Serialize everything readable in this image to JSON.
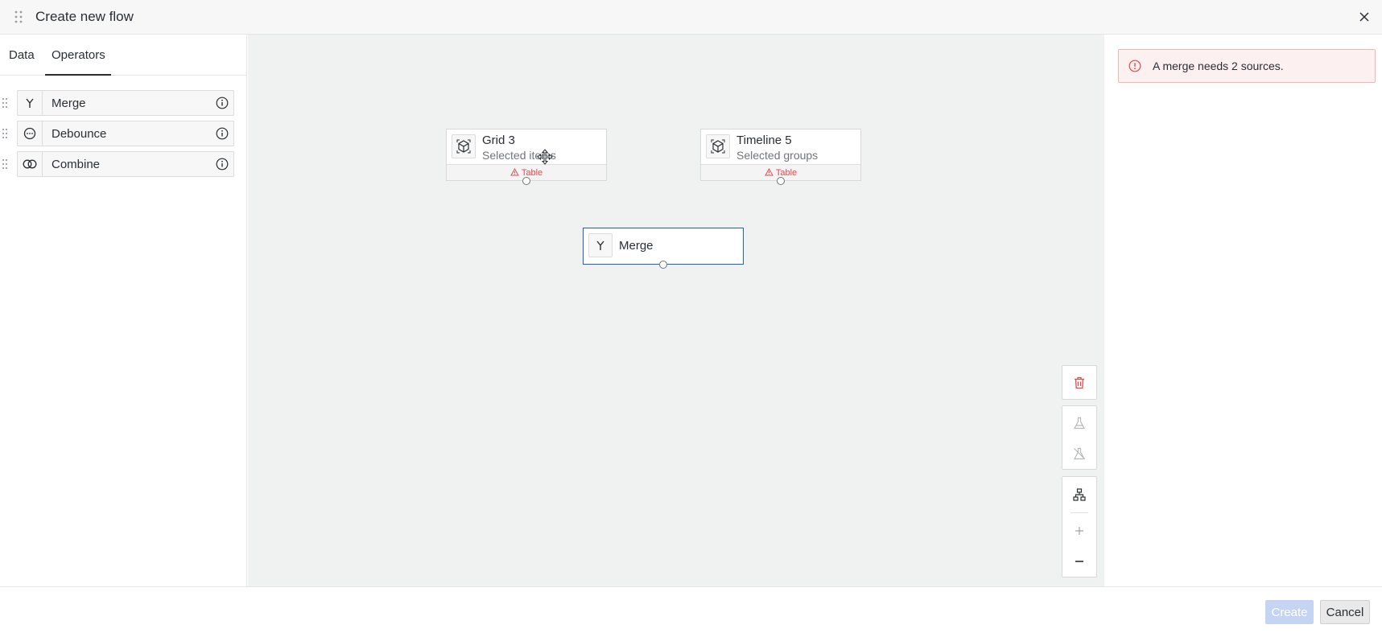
{
  "header": {
    "title": "Create new flow",
    "icons": {
      "grip": "drag-grip-icon",
      "close": "close-icon"
    }
  },
  "left_panel": {
    "tabs": [
      {
        "label": "Data",
        "active": false
      },
      {
        "label": "Operators",
        "active": true
      }
    ],
    "operators": [
      {
        "label": "Merge",
        "icon": "merge-icon"
      },
      {
        "label": "Debounce",
        "icon": "debounce-icon"
      },
      {
        "label": "Combine",
        "icon": "combine-icon"
      }
    ]
  },
  "canvas": {
    "nodes": [
      {
        "title": "Grid 3",
        "subtitle": "Selected items",
        "warning": "Table",
        "icon": "cube-icon"
      },
      {
        "title": "Timeline 5",
        "subtitle": "Selected groups",
        "warning": "Table",
        "icon": "cube-icon"
      },
      {
        "title": "Merge",
        "icon": "merge-icon",
        "selected": true
      }
    ],
    "controls": [
      "delete-icon",
      "flask-icon",
      "flask-off-icon",
      "hierarchy-icon",
      "plus-icon",
      "minus-icon"
    ]
  },
  "right_panel": {
    "error": {
      "message": "A merge needs 2 sources."
    }
  },
  "footer": {
    "create_label": "Create",
    "cancel_label": "Cancel"
  },
  "colors": {
    "accent": "#1e5fc7",
    "error": "#e5484d",
    "error_bg": "#fdf0f0",
    "canvas_bg": "#f0f1f1",
    "create_disabled": "#c5d4f2"
  }
}
